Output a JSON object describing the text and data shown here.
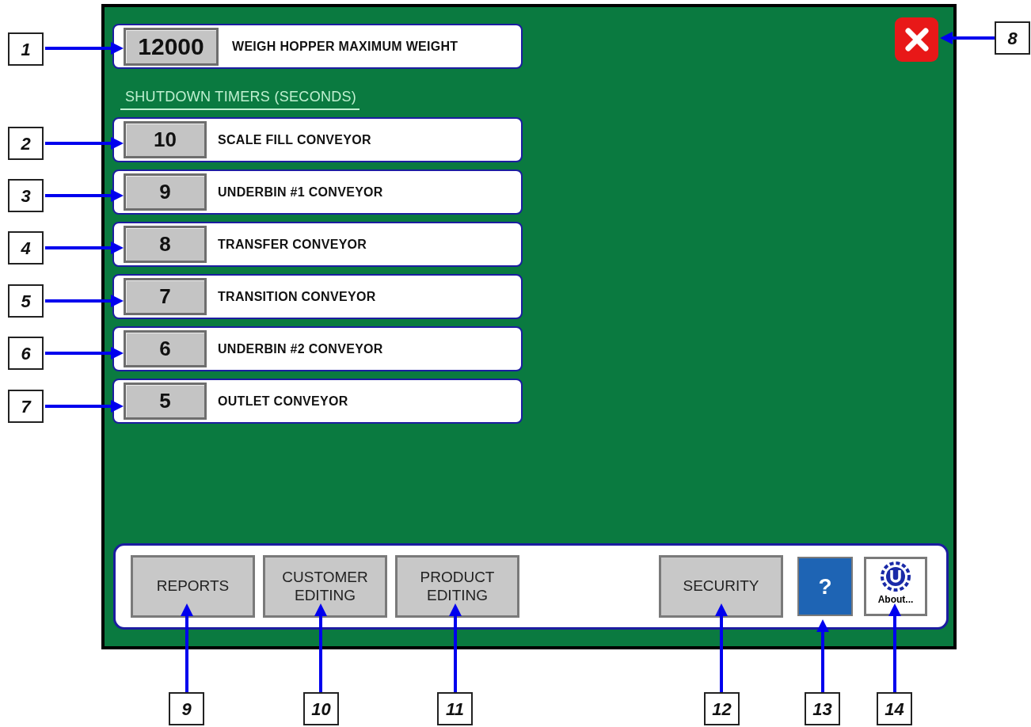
{
  "screen": {
    "max_weight": {
      "value": "12000",
      "label": "WEIGH HOPPER MAXIMUM WEIGHT"
    },
    "section_title": "SHUTDOWN TIMERS (SECONDS)",
    "timers": [
      {
        "value": "10",
        "label": "SCALE FILL CONVEYOR"
      },
      {
        "value": "9",
        "label": "UNDERBIN #1 CONVEYOR"
      },
      {
        "value": "8",
        "label": "TRANSFER CONVEYOR"
      },
      {
        "value": "7",
        "label": "TRANSITION CONVEYOR"
      },
      {
        "value": "6",
        "label": "UNDERBIN #2 CONVEYOR"
      },
      {
        "value": "5",
        "label": "OUTLET CONVEYOR"
      }
    ],
    "buttons": [
      {
        "kind": "text",
        "label": "REPORTS"
      },
      {
        "kind": "text",
        "label": "CUSTOMER EDITING"
      },
      {
        "kind": "text",
        "label": "PRODUCT EDITING"
      },
      {
        "kind": "text",
        "label": "SECURITY"
      },
      {
        "kind": "help",
        "label": "?"
      },
      {
        "kind": "about",
        "label": "About..."
      }
    ]
  },
  "callouts": [
    {
      "label": "1"
    },
    {
      "label": "2"
    },
    {
      "label": "3"
    },
    {
      "label": "4"
    },
    {
      "label": "5"
    },
    {
      "label": "6"
    },
    {
      "label": "7"
    },
    {
      "label": "8"
    },
    {
      "label": "9"
    },
    {
      "label": "10"
    },
    {
      "label": "11"
    },
    {
      "label": "12"
    },
    {
      "label": "13"
    },
    {
      "label": "14"
    }
  ]
}
